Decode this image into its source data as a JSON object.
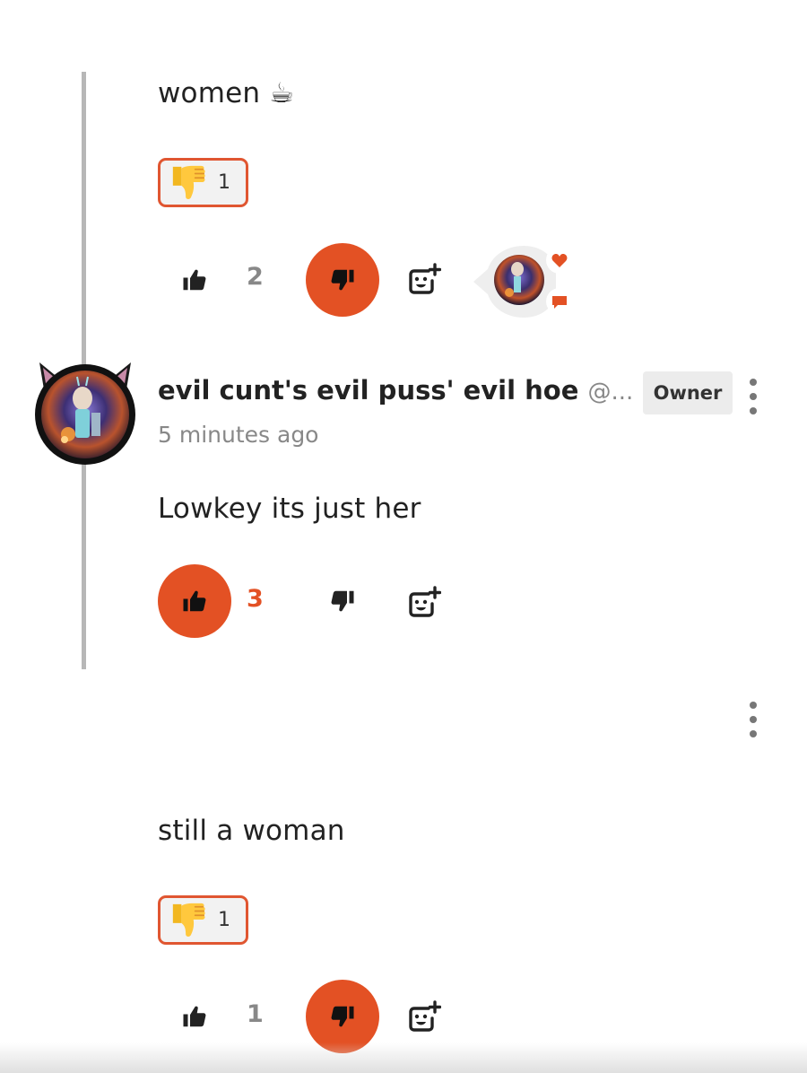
{
  "comment_1": {
    "text": "women ☕",
    "reaction_emoji": "thumbs-down-emoji",
    "reaction_count": "1",
    "like_count": "2",
    "actions": [
      "thumbs-up-icon",
      "thumbs-down-icon (active)",
      "add-emoji-icon"
    ],
    "reactor_indicators": [
      "heart-icon",
      "comment-icon"
    ]
  },
  "comment_2": {
    "author": "evil cunt's evil puss' evil hoe",
    "handle": "@...",
    "badge": "Owner",
    "timestamp": "5 minutes ago",
    "text": "Lowkey its just her",
    "like_count": "3",
    "actions": [
      "thumbs-up-icon (active)",
      "thumbs-down-icon",
      "add-emoji-icon"
    ]
  },
  "comment_3": {
    "text": "still a woman",
    "reaction_emoji": "thumbs-down-emoji",
    "reaction_count": "1",
    "like_count": "1",
    "actions": [
      "thumbs-up-icon",
      "thumbs-down-icon (active)",
      "add-emoji-icon"
    ]
  },
  "colors": {
    "accent": "#e35124",
    "muted_text": "#888888",
    "thread_line": "#b7b7b7",
    "badge_bg": "#ececec"
  }
}
